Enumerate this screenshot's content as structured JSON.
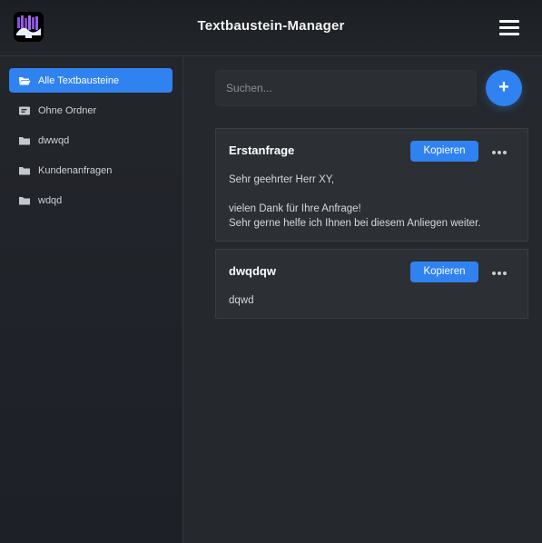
{
  "header": {
    "title": "Textbaustein-Manager",
    "logo_icon": "app-logo-icon",
    "menu_icon": "hamburger-menu-icon"
  },
  "sidebar": {
    "items": [
      {
        "label": "Alle Textbausteine",
        "icon": "folder-open-icon",
        "active": true
      },
      {
        "label": "Ohne Ordner",
        "icon": "no-folder-icon",
        "active": false
      },
      {
        "label": "dwwqd",
        "icon": "folder-icon",
        "active": false
      },
      {
        "label": "Kundenanfragen",
        "icon": "folder-icon",
        "active": false
      },
      {
        "label": "wdqd",
        "icon": "folder-icon",
        "active": false
      }
    ]
  },
  "search": {
    "placeholder": "Suchen...",
    "value": ""
  },
  "add_button": {
    "label": "+"
  },
  "cards": [
    {
      "title": "Erstanfrage",
      "copy_label": "Kopieren",
      "body_lines": [
        "Sehr geehrter Herr XY,",
        "",
        "vielen Dank für Ihre Anfrage!",
        "Sehr gerne helfe ich Ihnen bei diesem Anliegen weiter."
      ]
    },
    {
      "title": "dwqdqw",
      "copy_label": "Kopieren",
      "body_lines": [
        "dqwd"
      ]
    }
  ],
  "colors": {
    "accent": "#2f82f0",
    "background": "#25282d",
    "card": "#2c2f34"
  }
}
